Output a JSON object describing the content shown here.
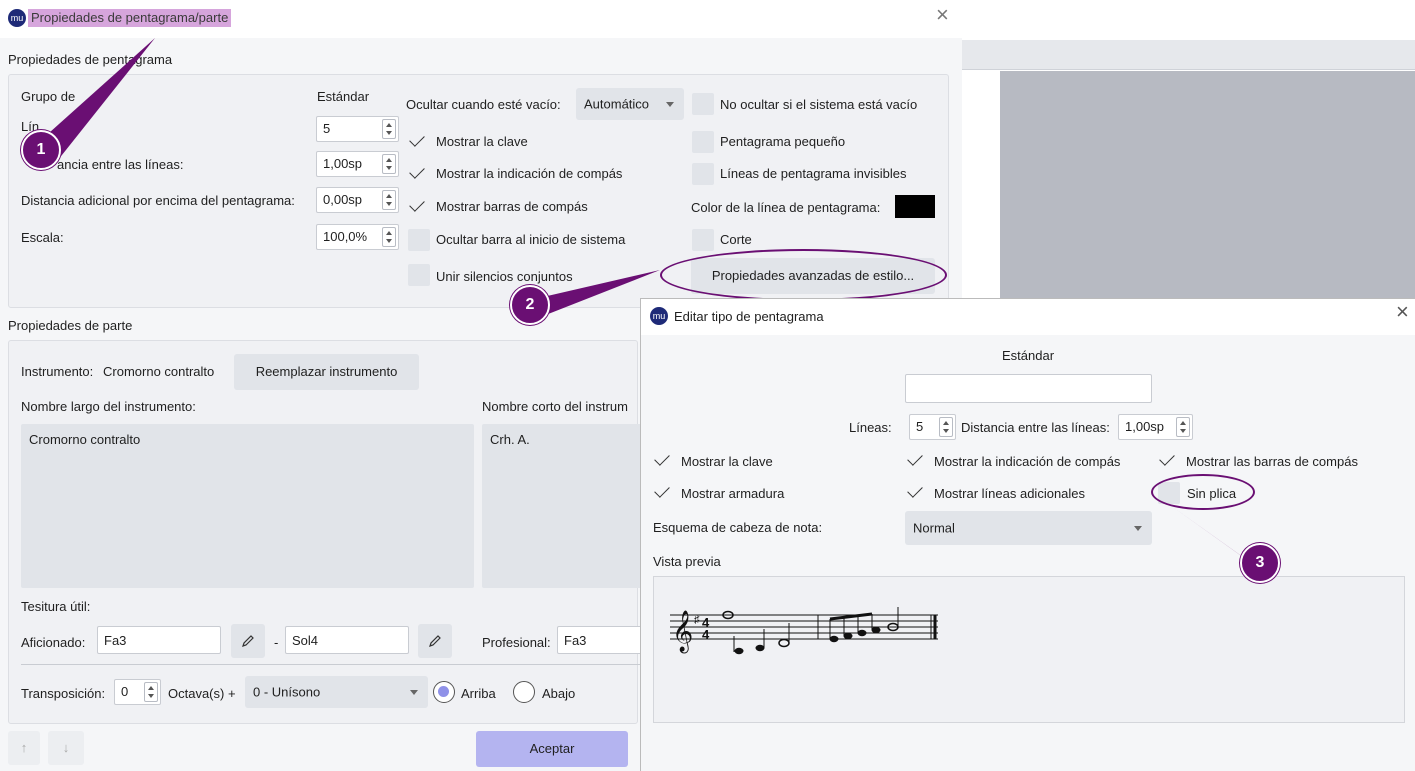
{
  "main": {
    "title": "Propiedades de pentagrama/parte",
    "staff_section": {
      "title": "Propiedades de pentagrama",
      "group_label": "Grupo de ",
      "group_value": "Estándar",
      "lines_label": "Lín",
      "lines_value": "5",
      "line_distance_label": "ancia entre las líneas:",
      "line_distance_value": "1,00sp",
      "extra_distance_label": "Distancia adicional por encima del pentagrama:",
      "extra_distance_value": "0,00sp",
      "scale_label": "Escala:",
      "scale_value": "100,0%",
      "hide_empty_label": "Ocultar cuando esté vacío:",
      "hide_empty_value": "Automático",
      "show_clef": "Mostrar la clave",
      "show_time_sig": "Mostrar la indicación de compás",
      "show_barlines": "Mostrar barras de compás",
      "hide_bar_start": "Ocultar barra al inicio de sistema",
      "merge_rests": "Unir silencios conjuntos",
      "no_hide_system": "No ocultar si el sistema está vacío",
      "small_staff": "Pentagrama pequeño",
      "invisible_lines": "Líneas de pentagrama invisibles",
      "line_color_label": "Color de la línea de pentagrama:",
      "line_color": "#000000",
      "cutaway": "Corte",
      "advanced_button": "Propiedades avanzadas de estilo..."
    },
    "part_section": {
      "title": "Propiedades de parte",
      "instrument_label": "Instrumento:",
      "instrument_value": "Cromorno contralto",
      "replace_button": "Reemplazar instrumento",
      "long_name_label": "Nombre largo del instrumento:",
      "long_name_value": "Cromorno contralto",
      "short_name_label": "Nombre corto del instrum",
      "short_name_value": "Crh. A.",
      "range_label": "Tesitura útil:",
      "amateur_label": "Aficionado:",
      "amateur_low": "Fa3",
      "dash": "-",
      "amateur_high": "Sol4",
      "pro_label": "Profesional:",
      "pro_low": "Fa3",
      "transposition_label": "Transposición:",
      "octave_value": "0",
      "octave_label": "Octava(s) +",
      "interval_value": "0 - Unísono",
      "up_label": "Arriba",
      "down_label": "Abajo"
    },
    "accept_button": "Aceptar",
    "close_icon": "×",
    "up_arrow": "↑",
    "down_arrow": "↓"
  },
  "editor": {
    "title": "Editar tipo de pentagrama",
    "type_name": "Estándar",
    "name_input": "",
    "lines_label": "Líneas:",
    "lines_value": "5",
    "distance_label": "Distancia entre las líneas:",
    "distance_value": "1,00sp",
    "show_clef": "Mostrar la clave",
    "show_time_sig": "Mostrar la indicación de compás",
    "show_barlines": "Mostrar las barras de compás",
    "show_key_sig": "Mostrar armadura",
    "show_ledger": "Mostrar líneas adicionales",
    "stemless": "Sin plica",
    "notehead_label": "Esquema de cabeza de nota:",
    "notehead_value": "Normal",
    "preview_label": "Vista previa",
    "close_icon": "×"
  },
  "badges": [
    "1",
    "2",
    "3"
  ],
  "colors": {
    "accent": "#6a0f73",
    "highlight": "#d6a5dc",
    "primary_button": "#b4b4f0"
  }
}
